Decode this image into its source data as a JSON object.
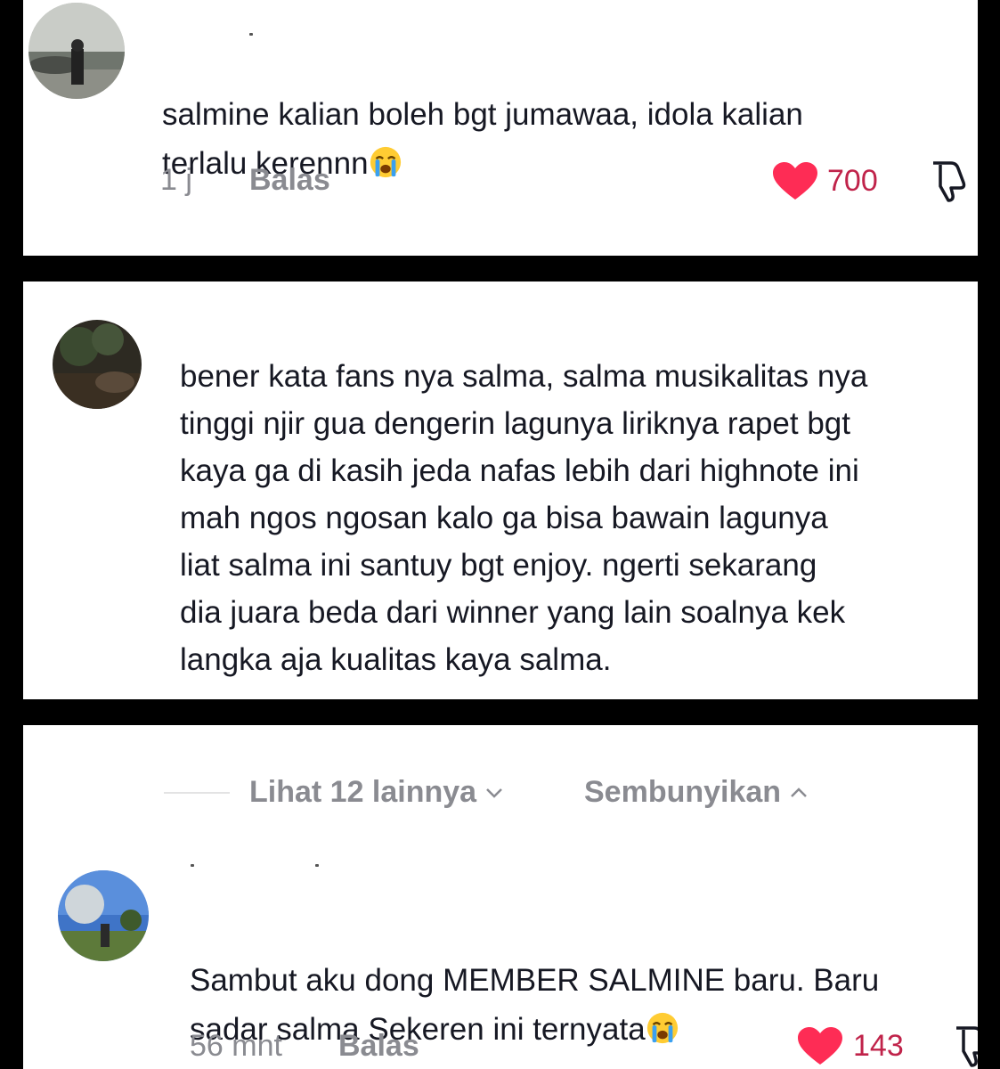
{
  "comments": [
    {
      "text": "salmine kalian boleh bgt jumawaa, idola kalian\nterlalu kerennn",
      "emoji": "loudly-crying-face",
      "time": "1 j",
      "reply_label": "Balas",
      "likes": "700"
    },
    {
      "text": "bener kata fans nya salma, salma musikalitas nya\ntinggi njir gua dengerin lagunya liriknya rapet bgt\nkaya ga di kasih jeda nafas lebih dari highnote ini\nmah ngos ngosan kalo ga bisa bawain lagunya\nliat salma ini santuy bgt enjoy. ngerti sekarang\ndia juara beda dari winner yang lain soalnya kek\nlangka aja kualitas kaya salma."
    },
    {
      "text": "Sambut aku dong MEMBER SALMINE baru. Baru\nsadar salma Sekeren ini ternyata",
      "emoji": "loudly-crying-face",
      "time": "56 mnt",
      "reply_label": "Balas",
      "likes": "143"
    }
  ],
  "thread": {
    "view_more": "Lihat 12 lainnya",
    "hide": "Sembunyikan"
  },
  "icons": {
    "like": "heart-icon",
    "dislike": "thumbs-down-icon",
    "expand": "chevron-down-icon",
    "collapse": "chevron-up-icon"
  },
  "colors": {
    "heart": "#fe2c55",
    "like_count": "#c0234a",
    "muted": "#8a8b91",
    "text": "#161823",
    "separator": "#000000"
  }
}
